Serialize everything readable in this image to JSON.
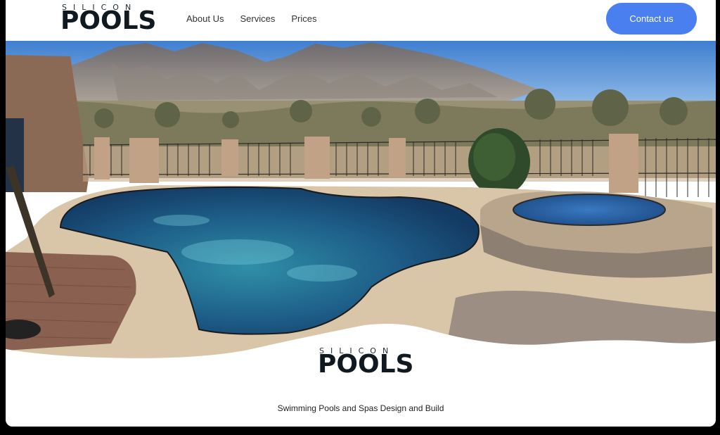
{
  "header": {
    "logo_top": "SILICON",
    "logo_main": "POOLS",
    "nav": [
      "About Us",
      "Services",
      "Prices"
    ],
    "contact_label": "Contact us"
  },
  "hero": {
    "logo_top": "SILICON",
    "logo_main": "POOLS",
    "tagline": "Swimming Pools and Spas Design and Build"
  },
  "colors": {
    "accent": "#4a7ff0",
    "pool": "#1e5a8c",
    "sky": "#6aa8e0"
  }
}
